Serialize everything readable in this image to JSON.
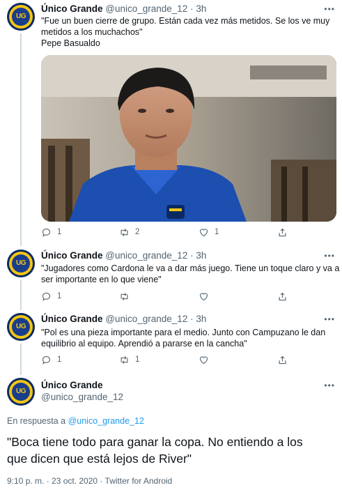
{
  "tweets": [
    {
      "name": "Único Grande",
      "handle": "@unico_grande_12",
      "separator": "·",
      "time": "3h",
      "avatar_text": "UG",
      "text_lines": [
        "\"Fue un buen cierre de grupo. Están cada vez más metidos. Se los ve muy",
        "metidos a los muchachos\"",
        "Pepe Basualdo"
      ],
      "replies": "1",
      "retweets": "2",
      "likes": "1"
    },
    {
      "name": "Único Grande",
      "handle": "@unico_grande_12",
      "separator": "·",
      "time": "3h",
      "avatar_text": "UG",
      "text_lines": [
        "\"Jugadores como Cardona le va a dar más juego. Tiene un toque claro y va a",
        "ser importante en lo que viene\""
      ],
      "replies": "1",
      "retweets": "",
      "likes": ""
    },
    {
      "name": "Único Grande",
      "handle": "@unico_grande_12",
      "separator": "·",
      "time": "3h",
      "avatar_text": "UG",
      "text_lines": [
        "\"Pol es una pieza importante para el medio. Junto con Campuzano le dan",
        "equilibrio al equipo. Aprendió a pararse en la cancha\""
      ],
      "replies": "1",
      "retweets": "1",
      "likes": ""
    }
  ],
  "main_tweet": {
    "name": "Único Grande",
    "handle": "@unico_grande_12",
    "avatar_text": "UG",
    "reply_prefix": "En respuesta a",
    "reply_handle": "@unico_grande_12",
    "text_lines": [
      "\"Boca tiene todo para ganar la copa. No entiendo a los",
      "que dicen que está lejos de River\""
    ],
    "meta": "9:10 p. m. · 23 oct. 2020 · Twitter for Android"
  },
  "colors": {
    "accent": "#1d9bf0",
    "muted": "#536471",
    "boca_blue": "#0b2a62",
    "boca_gold": "#f3c613"
  },
  "icons": {
    "reply": "reply-icon",
    "retweet": "retweet-icon",
    "like": "heart-icon",
    "share": "share-icon",
    "more": "more-icon"
  }
}
